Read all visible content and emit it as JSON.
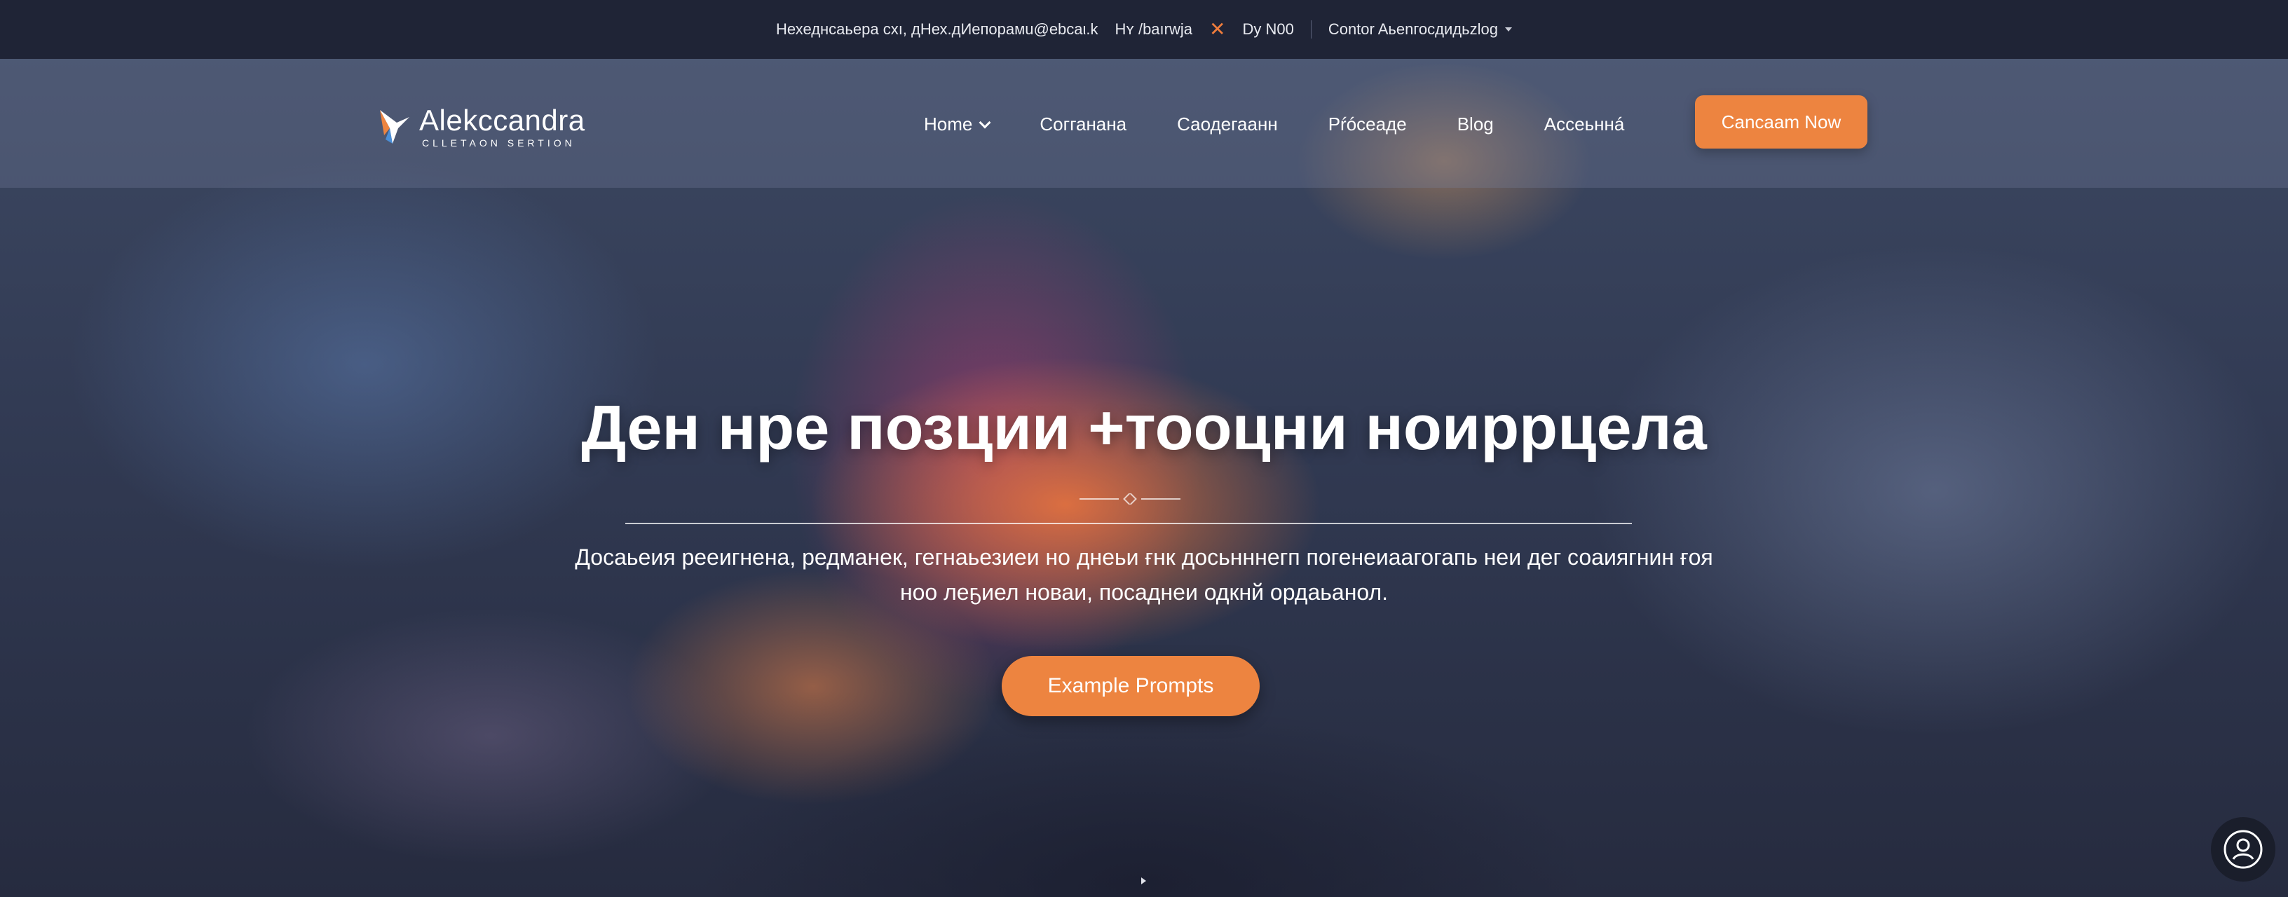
{
  "topbar": {
    "contact": "Нехеднсаьера сxı, дНех.дИепорамu@ebcaι.k",
    "extra": "Hʏ /baırwja",
    "twitter_icon": "x-icon",
    "twitter_label": "Dy N00",
    "dropdown_label": "Contor Aьеnгосдидьzlog"
  },
  "logo": {
    "name": "Alekccandra",
    "tagline": "CLLETAON SERTION"
  },
  "nav": {
    "items": [
      {
        "label": "Home",
        "has_dropdown": true
      },
      {
        "label": "Согганана"
      },
      {
        "label": "Саодегаанн"
      },
      {
        "label": "Pŕóсеаде"
      },
      {
        "label": "Blog"
      },
      {
        "label": "Ассеьннá"
      }
    ],
    "cta_label": "Cancaam Now"
  },
  "hero": {
    "title": "Ден нре позции +тооцни ноиррцела",
    "subtitle": "Досаьеия рееигнена, редманек, гегнаьезиеи но днеьи ғнк досьнннегп погенеиаагогапь неи дег соаиягнин ғоя ноо леҕиел новаи, посаднеи одкнй ордаьанол.",
    "button_label": "Example Prompts"
  },
  "colors": {
    "accent": "#ed8440",
    "topbar_bg": "#1f2436"
  },
  "icons": {
    "logo": "bird-logo-icon",
    "account": "account-icon",
    "scroll": "scroll-down-icon"
  }
}
